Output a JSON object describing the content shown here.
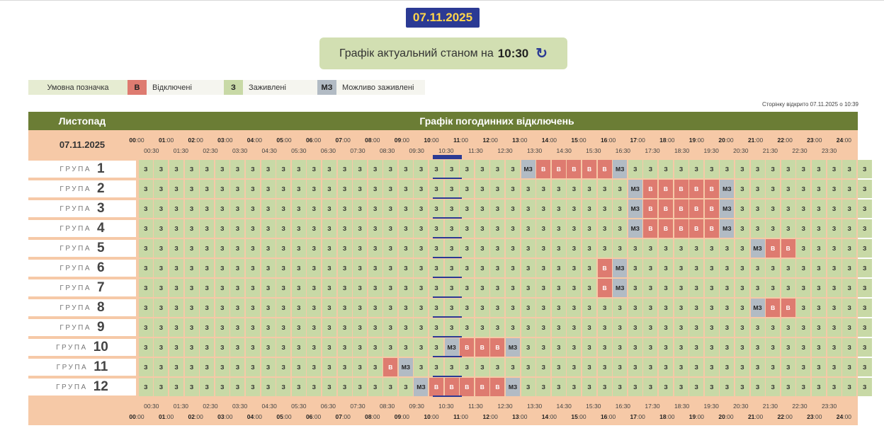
{
  "date_badge": "07.11.2025",
  "actual": {
    "text": "Графік актуальний станом на",
    "time": "10:30",
    "refresh_icon": "refresh-icon"
  },
  "legend": {
    "caption": "Умовна позначка",
    "items": [
      {
        "code": "В",
        "label": "Відключені",
        "color": "#de7b70"
      },
      {
        "code": "З",
        "label": "Заживлені",
        "color": "#c8d9a6"
      },
      {
        "code": "МЗ",
        "label": "Можливо заживлені",
        "color": "#b2bbc4"
      }
    ]
  },
  "opened_note": "Сторінку відкрито 07.11.2025 о 10:39",
  "header": {
    "month": "Листопад",
    "title": "Графік погодинних відключень"
  },
  "table_date": "07.11.2025",
  "group_word": "ГРУПА",
  "groups": [
    {
      "num": "1",
      "cells": [
        "З",
        "З",
        "З",
        "З",
        "З",
        "З",
        "З",
        "З",
        "З",
        "З",
        "З",
        "З",
        "З",
        "З",
        "З",
        "З",
        "З",
        "З",
        "З",
        "З",
        "З",
        "З",
        "З",
        "З",
        "З",
        "МЗ",
        "В",
        "В",
        "В",
        "В",
        "В",
        "МЗ",
        "З",
        "З",
        "З",
        "З",
        "З",
        "З",
        "З",
        "З",
        "З",
        "З",
        "З",
        "З",
        "З",
        "З",
        "З",
        "З"
      ]
    },
    {
      "num": "2",
      "cells": [
        "З",
        "З",
        "З",
        "З",
        "З",
        "З",
        "З",
        "З",
        "З",
        "З",
        "З",
        "З",
        "З",
        "З",
        "З",
        "З",
        "З",
        "З",
        "З",
        "З",
        "З",
        "З",
        "З",
        "З",
        "З",
        "З",
        "З",
        "З",
        "З",
        "З",
        "З",
        "З",
        "МЗ",
        "В",
        "В",
        "В",
        "В",
        "В",
        "МЗ",
        "З",
        "З",
        "З",
        "З",
        "З",
        "З",
        "З",
        "З",
        "З"
      ]
    },
    {
      "num": "3",
      "cells": [
        "З",
        "З",
        "З",
        "З",
        "З",
        "З",
        "З",
        "З",
        "З",
        "З",
        "З",
        "З",
        "З",
        "З",
        "З",
        "З",
        "З",
        "З",
        "З",
        "З",
        "З",
        "З",
        "З",
        "З",
        "З",
        "З",
        "З",
        "З",
        "З",
        "З",
        "З",
        "З",
        "МЗ",
        "В",
        "В",
        "В",
        "В",
        "В",
        "МЗ",
        "З",
        "З",
        "З",
        "З",
        "З",
        "З",
        "З",
        "З",
        "З"
      ]
    },
    {
      "num": "4",
      "cells": [
        "З",
        "З",
        "З",
        "З",
        "З",
        "З",
        "З",
        "З",
        "З",
        "З",
        "З",
        "З",
        "З",
        "З",
        "З",
        "З",
        "З",
        "З",
        "З",
        "З",
        "З",
        "З",
        "З",
        "З",
        "З",
        "З",
        "З",
        "З",
        "З",
        "З",
        "З",
        "З",
        "МЗ",
        "В",
        "В",
        "В",
        "В",
        "В",
        "МЗ",
        "З",
        "З",
        "З",
        "З",
        "З",
        "З",
        "З",
        "З",
        "З"
      ]
    },
    {
      "num": "5",
      "cells": [
        "З",
        "З",
        "З",
        "З",
        "З",
        "З",
        "З",
        "З",
        "З",
        "З",
        "З",
        "З",
        "З",
        "З",
        "З",
        "З",
        "З",
        "З",
        "З",
        "З",
        "З",
        "З",
        "З",
        "З",
        "З",
        "З",
        "З",
        "З",
        "З",
        "З",
        "З",
        "З",
        "З",
        "З",
        "З",
        "З",
        "З",
        "З",
        "З",
        "З",
        "МЗ",
        "В",
        "В",
        "З",
        "З",
        "З",
        "З",
        "З"
      ]
    },
    {
      "num": "6",
      "cells": [
        "З",
        "З",
        "З",
        "З",
        "З",
        "З",
        "З",
        "З",
        "З",
        "З",
        "З",
        "З",
        "З",
        "З",
        "З",
        "З",
        "З",
        "З",
        "З",
        "З",
        "З",
        "З",
        "З",
        "З",
        "З",
        "З",
        "З",
        "З",
        "З",
        "З",
        "В",
        "МЗ",
        "З",
        "З",
        "З",
        "З",
        "З",
        "З",
        "З",
        "З",
        "З",
        "З",
        "З",
        "З",
        "З",
        "З",
        "З",
        "З"
      ]
    },
    {
      "num": "7",
      "cells": [
        "З",
        "З",
        "З",
        "З",
        "З",
        "З",
        "З",
        "З",
        "З",
        "З",
        "З",
        "З",
        "З",
        "З",
        "З",
        "З",
        "З",
        "З",
        "З",
        "З",
        "З",
        "З",
        "З",
        "З",
        "З",
        "З",
        "З",
        "З",
        "З",
        "З",
        "В",
        "МЗ",
        "З",
        "З",
        "З",
        "З",
        "З",
        "З",
        "З",
        "З",
        "З",
        "З",
        "З",
        "З",
        "З",
        "З",
        "З",
        "З"
      ]
    },
    {
      "num": "8",
      "cells": [
        "З",
        "З",
        "З",
        "З",
        "З",
        "З",
        "З",
        "З",
        "З",
        "З",
        "З",
        "З",
        "З",
        "З",
        "З",
        "З",
        "З",
        "З",
        "З",
        "З",
        "З",
        "З",
        "З",
        "З",
        "З",
        "З",
        "З",
        "З",
        "З",
        "З",
        "З",
        "З",
        "З",
        "З",
        "З",
        "З",
        "З",
        "З",
        "З",
        "З",
        "МЗ",
        "В",
        "В",
        "З",
        "З",
        "З",
        "З",
        "З"
      ]
    },
    {
      "num": "9",
      "cells": [
        "З",
        "З",
        "З",
        "З",
        "З",
        "З",
        "З",
        "З",
        "З",
        "З",
        "З",
        "З",
        "З",
        "З",
        "З",
        "З",
        "З",
        "З",
        "З",
        "З",
        "З",
        "З",
        "З",
        "З",
        "З",
        "З",
        "З",
        "З",
        "З",
        "З",
        "З",
        "З",
        "З",
        "З",
        "З",
        "З",
        "З",
        "З",
        "З",
        "З",
        "З",
        "З",
        "З",
        "З",
        "З",
        "З",
        "З",
        "З"
      ]
    },
    {
      "num": "10",
      "cells": [
        "З",
        "З",
        "З",
        "З",
        "З",
        "З",
        "З",
        "З",
        "З",
        "З",
        "З",
        "З",
        "З",
        "З",
        "З",
        "З",
        "З",
        "З",
        "З",
        "З",
        "МЗ",
        "В",
        "В",
        "В",
        "МЗ",
        "З",
        "З",
        "З",
        "З",
        "З",
        "З",
        "З",
        "З",
        "З",
        "З",
        "З",
        "З",
        "З",
        "З",
        "З",
        "З",
        "З",
        "З",
        "З",
        "З",
        "З",
        "З",
        "З"
      ]
    },
    {
      "num": "11",
      "cells": [
        "З",
        "З",
        "З",
        "З",
        "З",
        "З",
        "З",
        "З",
        "З",
        "З",
        "З",
        "З",
        "З",
        "З",
        "З",
        "З",
        "В",
        "МЗ",
        "З",
        "З",
        "З",
        "З",
        "З",
        "З",
        "З",
        "З",
        "З",
        "З",
        "З",
        "З",
        "З",
        "З",
        "З",
        "З",
        "З",
        "З",
        "З",
        "З",
        "З",
        "З",
        "З",
        "З",
        "З",
        "З",
        "З",
        "З",
        "З",
        "З"
      ]
    },
    {
      "num": "12",
      "cells": [
        "З",
        "З",
        "З",
        "З",
        "З",
        "З",
        "З",
        "З",
        "З",
        "З",
        "З",
        "З",
        "З",
        "З",
        "З",
        "З",
        "З",
        "З",
        "МЗ",
        "В",
        "В",
        "В",
        "В",
        "В",
        "МЗ",
        "З",
        "З",
        "З",
        "З",
        "З",
        "З",
        "З",
        "З",
        "З",
        "З",
        "З",
        "З",
        "З",
        "З",
        "З",
        "З",
        "З",
        "З",
        "З",
        "З",
        "З",
        "З",
        "З"
      ]
    }
  ]
}
